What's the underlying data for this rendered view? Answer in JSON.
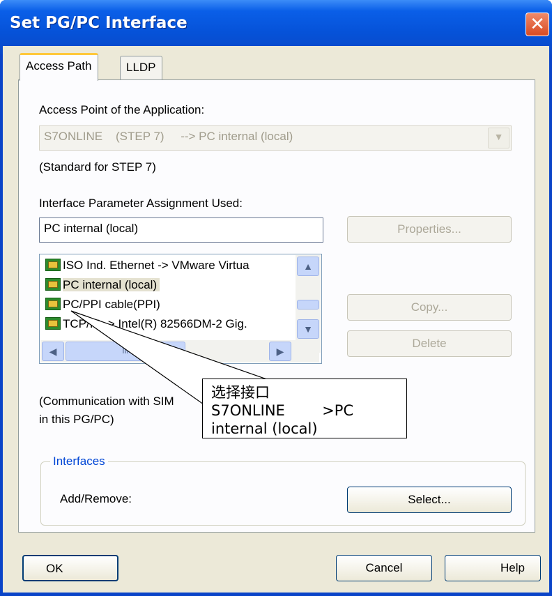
{
  "window": {
    "title": "Set PG/PC Interface",
    "close_glyph": "✕",
    "accent_color": "#0a5fe8"
  },
  "tabs": [
    {
      "label": "Access Path",
      "active": true
    },
    {
      "label": "LLDP",
      "active": false
    }
  ],
  "access_point": {
    "label": "Access Point of the Application:",
    "value": "S7ONLINE    (STEP 7)     --> PC internal (local)",
    "note": "(Standard for STEP 7)"
  },
  "param_assignment": {
    "label": "Interface Parameter Assignment Used:",
    "value": "PC internal (local)"
  },
  "buttons": {
    "properties": "Properties...",
    "copy": "Copy...",
    "delete": "Delete",
    "select": "Select...",
    "ok": "OK",
    "cancel": "Cancel",
    "help": "Help"
  },
  "interface_list": {
    "items": [
      {
        "label": "ISO Ind. Ethernet -> VMware Virtua",
        "selected": false
      },
      {
        "label": "PC internal (local)",
        "selected": true
      },
      {
        "label": "PC/PPI cable(PPI)",
        "selected": false
      },
      {
        "label": "TCP/IP -> Intel(R) 82566DM-2 Gig.",
        "selected": false
      }
    ],
    "scroll_up": "▲",
    "scroll_down": "▼",
    "scroll_left": "◀",
    "scroll_right": "▶",
    "thumb_grip": "III"
  },
  "description": {
    "line1": "(Communication with SIM",
    "line2": "in this PG/PC)"
  },
  "interfaces_group": {
    "legend": "Interfaces",
    "add_remove": "Add/Remove:"
  },
  "callout": {
    "line1": "选择接口",
    "line2": "S7ONLINE        >PC",
    "line3": "internal (local)"
  }
}
